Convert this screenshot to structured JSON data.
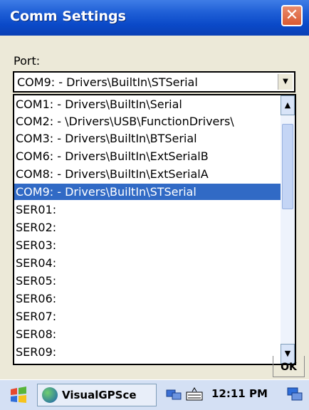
{
  "window": {
    "title": "Comm Settings",
    "close_glyph": "✕"
  },
  "port": {
    "label": "Port:",
    "selected_value": "COM9: - Drivers\\BuiltIn\\STSerial",
    "options": [
      "COM1: - Drivers\\BuiltIn\\Serial",
      "COM2: - \\Drivers\\USB\\FunctionDrivers\\",
      "COM3: - Drivers\\BuiltIn\\BTSerial",
      "COM6: - Drivers\\BuiltIn\\ExtSerialB",
      "COM8: - Drivers\\BuiltIn\\ExtSerialA",
      "COM9: - Drivers\\BuiltIn\\STSerial",
      "SER01:",
      "SER02:",
      "SER03:",
      "SER04:",
      "SER05:",
      "SER06:",
      "SER07:",
      "SER08:",
      "SER09:"
    ],
    "selected_index": 5
  },
  "dialog": {
    "ok_partial": "OK"
  },
  "taskbar": {
    "start_icon": "windows-flag-icon",
    "task_label": "VisualGPSce",
    "clock": "12:11 PM",
    "tray_icons": [
      "network-icon",
      "keyboard-icon",
      "desktop-icon"
    ]
  },
  "colors": {
    "title_bar": "#0a49c8",
    "selection": "#316ac5",
    "close_button": "#d95a32"
  }
}
